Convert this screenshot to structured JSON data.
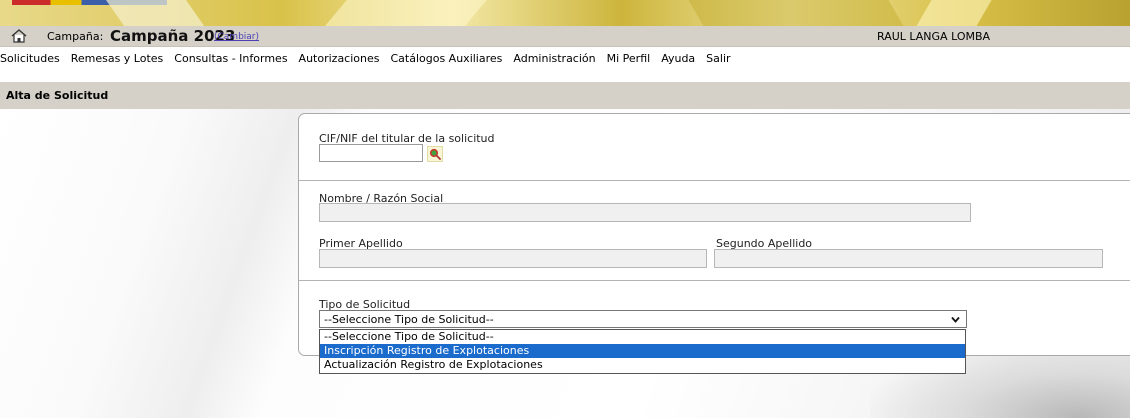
{
  "header": {
    "campaign_prefix": "Campaña:",
    "campaign_name": "Campaña 2023",
    "change_link": "(Cambiar)",
    "username": "RAUL LANGA LOMBA"
  },
  "menu": {
    "items": [
      "Solicitudes",
      "Remesas y Lotes",
      "Consultas - Informes",
      "Autorizaciones",
      "Catálogos Auxiliares",
      "Administración",
      "Mi Perfil",
      "Ayuda",
      "Salir"
    ]
  },
  "section": {
    "title": "Alta de Solicitud"
  },
  "form": {
    "cif_label": "CIF/NIF del titular de la solicitud",
    "cif_value": "",
    "nombre_label": "Nombre / Razón Social",
    "nombre_value": "",
    "primer_apellido_label": "Primer Apellido",
    "primer_apellido_value": "",
    "segundo_apellido_label": "Segundo Apellido",
    "segundo_apellido_value": "",
    "tipo_label": "Tipo de Solicitud",
    "tipo_selected": "--Seleccione Tipo de Solicitud--",
    "tipo_options": [
      "--Seleccione Tipo de Solicitud--",
      "Inscripción Registro de Explotaciones",
      "Actualización Registro de Explotaciones"
    ],
    "highlighted_option_index": 1
  },
  "colors": {
    "bar_bg": "#d5d0c8",
    "highlight": "#1b6bcc",
    "link": "#4a3fb5"
  },
  "icons": {
    "home": "home-icon",
    "search": "search-icon",
    "dropdown": "chevron-down-icon"
  }
}
